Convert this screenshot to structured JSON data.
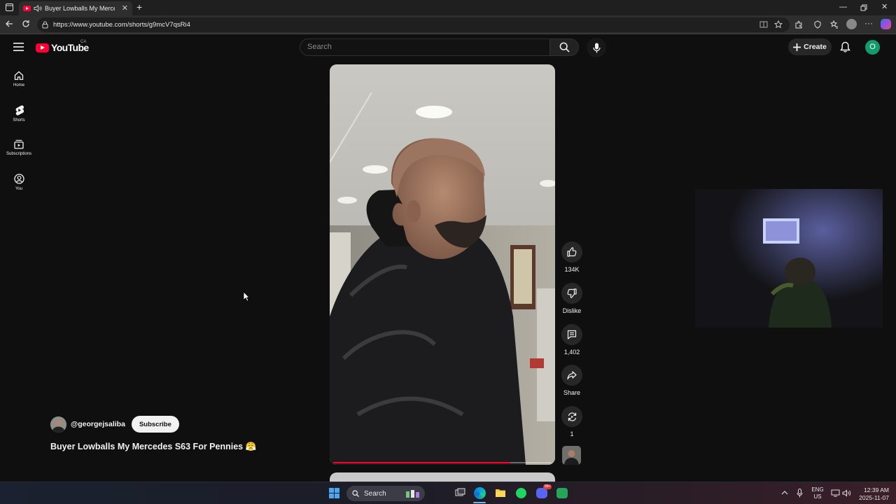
{
  "browser": {
    "tab_title": "Buyer Lowballs My Mercedes",
    "url": "https://www.youtube.com/shorts/g9mcV7qsRi4"
  },
  "youtube": {
    "logo_text": "YouTube",
    "country": "CA",
    "search_placeholder": "Search",
    "create_label": "Create",
    "avatar_initial": "O"
  },
  "sidebar": {
    "items": [
      {
        "label": "Home",
        "icon": "home-icon"
      },
      {
        "label": "Shorts",
        "icon": "shorts-icon"
      },
      {
        "label": "Subscriptions",
        "icon": "subscriptions-icon"
      },
      {
        "label": "You",
        "icon": "you-icon"
      }
    ]
  },
  "short": {
    "channel": "@georgejsaliba",
    "subscribe_label": "Subscribe",
    "title": "Buyer Lowballs My Mercedes S63 For Pennies 😤",
    "progress": 0.81,
    "actions": {
      "likes": "134K",
      "dislike": "Dislike",
      "comments": "1,402",
      "share": "Share",
      "remix": "1"
    }
  },
  "taskbar": {
    "search_label": "Search",
    "lang_top": "ENG",
    "lang_bottom": "US",
    "time": "12:39 AM",
    "date": "2025-11-07",
    "discord_badge": "99+"
  }
}
